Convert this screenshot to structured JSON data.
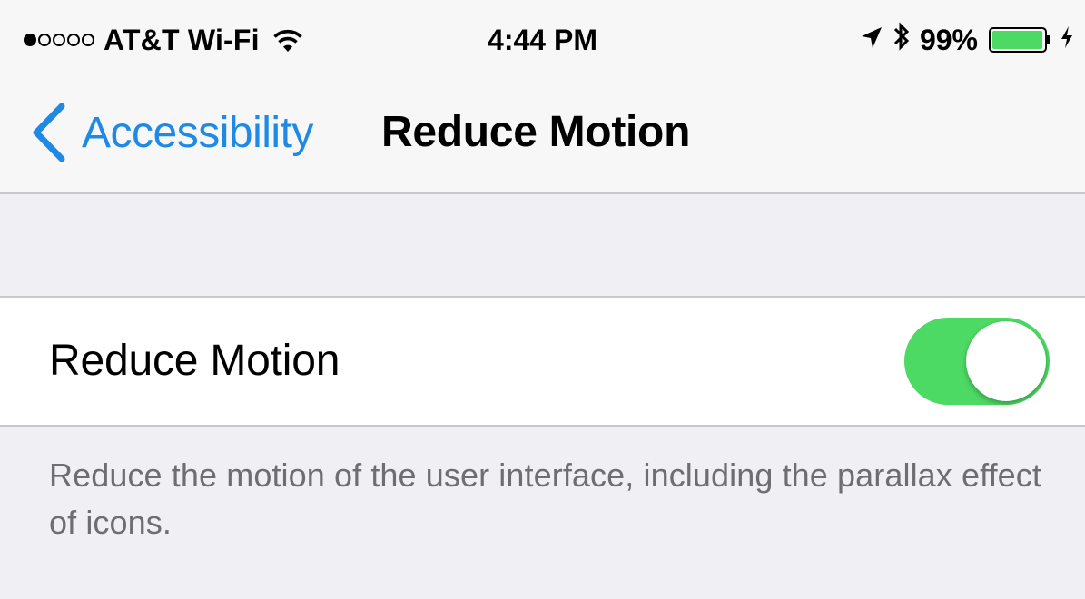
{
  "status_bar": {
    "signal": {
      "filled": 1,
      "total": 5
    },
    "carrier": "AT&T Wi-Fi",
    "wifi_icon": "wifi-icon",
    "time": "4:44 PM",
    "location_icon": "location-arrow-icon",
    "bluetooth_icon": "bluetooth-icon",
    "battery_percent_text": "99%",
    "battery_level": 0.99,
    "charging_icon": "charging-bolt-icon",
    "battery_color": "#4cd964"
  },
  "nav_bar": {
    "back_icon": "chevron-left-icon",
    "back_label": "Accessibility",
    "title": "Reduce Motion",
    "accent_color": "#1f8ae6"
  },
  "settings": {
    "reduce_motion": {
      "label": "Reduce Motion",
      "enabled": true,
      "toggle_on_color": "#4cd964"
    },
    "footer": "Reduce the motion of the user interface, including the parallax effect of icons."
  }
}
